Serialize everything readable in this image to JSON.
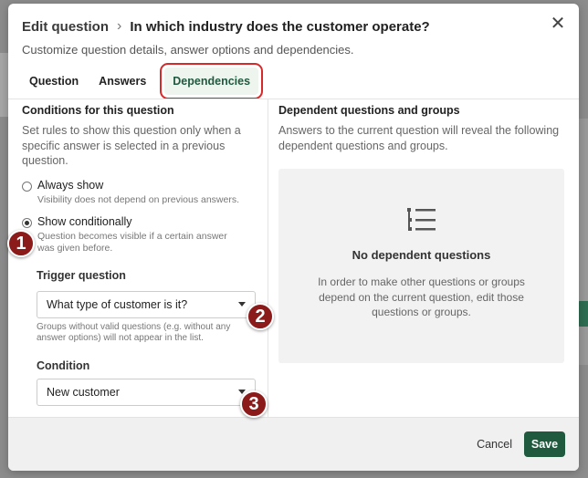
{
  "header": {
    "breadcrumb": "Edit question",
    "title": "In which industry does the customer operate?",
    "subtitle": "Customize question details, answer options and dependencies."
  },
  "tabs": [
    {
      "label": "Question",
      "active": false
    },
    {
      "label": "Answers",
      "active": false
    },
    {
      "label": "Dependencies",
      "active": true
    }
  ],
  "conditions": {
    "heading": "Conditions for this question",
    "description": "Set rules to show this question only when a specific answer is selected in a previous question.",
    "options": [
      {
        "label": "Always show",
        "sub": "Visibility does not depend on previous answers.",
        "selected": false
      },
      {
        "label": "Show conditionally",
        "sub": "Question becomes visible if a certain answer was given before.",
        "selected": true
      }
    ],
    "trigger_label": "Trigger question",
    "trigger_value": "What type of customer is it?",
    "trigger_hint": "Groups without valid questions (e.g. without any answer options) will not appear in the list.",
    "condition_label": "Condition",
    "condition_value": "New customer"
  },
  "dependents": {
    "heading": "Dependent questions and groups",
    "description": "Answers to the current question will reveal the following dependent questions and groups.",
    "empty_title": "No dependent questions",
    "empty_text": "In order to make other questions or groups depend on the current question, edit those questions or groups.",
    "icon": "list-tree-icon"
  },
  "footer": {
    "cancel_label": "Cancel",
    "save_label": "Save"
  },
  "annotations": [
    "1",
    "2",
    "3"
  ],
  "colors": {
    "primary": "#1f5a3f",
    "highlight": "#d62a2a",
    "marker": "#8b1a1a"
  }
}
